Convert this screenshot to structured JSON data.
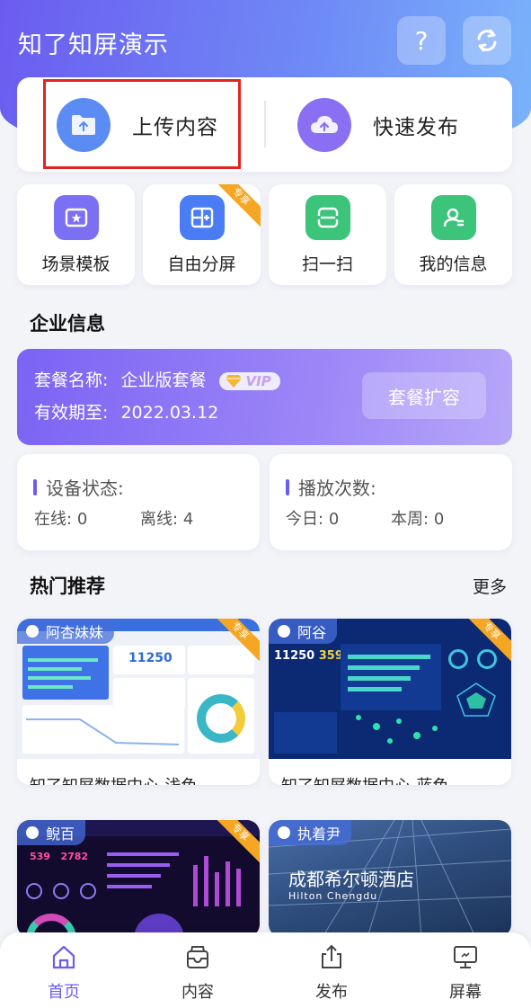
{
  "header": {
    "title": "知了知屏演示",
    "help_icon": "question-icon",
    "refresh_icon": "refresh-icon"
  },
  "actions": {
    "upload_label": "上传内容",
    "publish_label": "快速发布"
  },
  "quick": [
    {
      "label": "场景模板",
      "icon": "template-icon",
      "color": "#6b5cf0"
    },
    {
      "label": "自由分屏",
      "icon": "split-screen-icon",
      "color": "#4a7cf6",
      "badge": "专享"
    },
    {
      "label": "扫一扫",
      "icon": "scan-icon",
      "color": "#3bc47a"
    },
    {
      "label": "我的信息",
      "icon": "profile-icon",
      "color": "#3bc47a"
    }
  ],
  "company": {
    "title": "企业信息",
    "plan_label": "套餐名称:",
    "plan_value": "企业版套餐",
    "vip": "VIP",
    "expire_label": "有效期至:",
    "expire_value": "2022.03.12",
    "expand_button": "套餐扩容"
  },
  "device": {
    "title": "设备状态:",
    "online_label": "在线:",
    "online": "0",
    "offline_label": "离线:",
    "offline": "4"
  },
  "play": {
    "title": "播放次数:",
    "today_label": "今日:",
    "today": "0",
    "week_label": "本周:",
    "week": "0"
  },
  "recommend": {
    "title": "热门推荐",
    "more": "更多",
    "items": [
      {
        "user": "阿杏妹妹",
        "title": "知了知屏数据中心-浅色",
        "badge": "专享"
      },
      {
        "user": "阿谷",
        "title": "知了知屏数据中心-蓝色",
        "badge": "专享"
      },
      {
        "user": "鲵百",
        "title": "",
        "badge": "专享"
      },
      {
        "user": "执着尹",
        "title": "",
        "hotel": "成都希尔顿酒店",
        "hotel_en": "Hilton Chengdu"
      }
    ],
    "thumb_text": {
      "num1": "11250",
      "num2": "359",
      "light_header": "知了知屏数据中心"
    }
  },
  "nav": [
    {
      "label": "首页",
      "icon": "home-icon"
    },
    {
      "label": "内容",
      "icon": "inbox-icon"
    },
    {
      "label": "发布",
      "icon": "share-icon"
    },
    {
      "label": "屏幕",
      "icon": "monitor-icon"
    }
  ],
  "colors": {
    "accent": "#6b5cf0",
    "badge": "#f5a623",
    "highlight": "#e52222"
  }
}
